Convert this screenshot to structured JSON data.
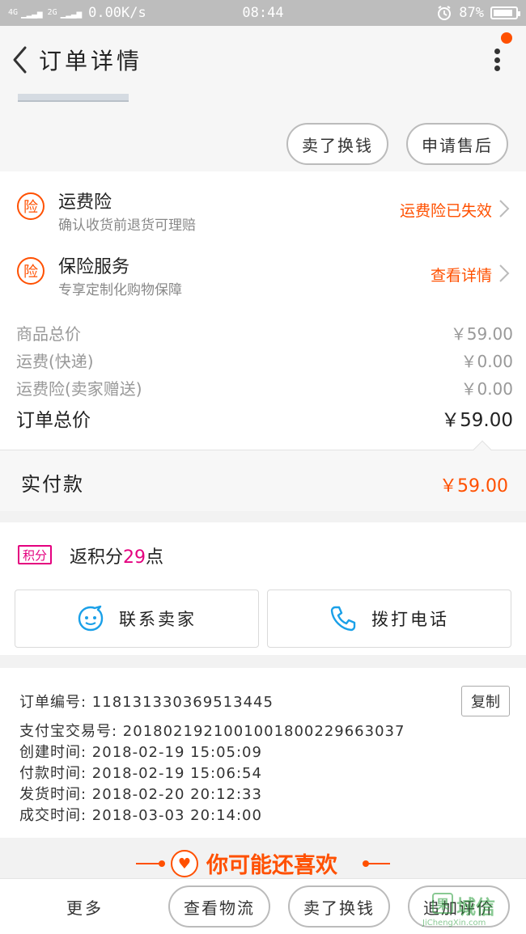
{
  "status_bar": {
    "signal_left": "4G",
    "signal_right": "2G",
    "net_speed": "0.00K/s",
    "time": "08:44",
    "battery": "87%",
    "battery_level": 0.87
  },
  "nav": {
    "title": "订单详情"
  },
  "actions_top": {
    "btn1": "卖了换钱",
    "btn2": "申请售后"
  },
  "insurance": [
    {
      "icon": "险",
      "title": "运费险",
      "subtitle": "确认收货前退货可理赔",
      "link": "运费险已失效"
    },
    {
      "icon": "险",
      "title": "保险服务",
      "subtitle": "专享定制化购物保障",
      "link": "查看详情"
    }
  ],
  "prices": {
    "goods_label": "商品总价",
    "goods_value": "￥59.00",
    "shipping_label": "运费(快递)",
    "shipping_value": "￥0.00",
    "ins_label": "运费险(卖家赠送)",
    "ins_value": "￥0.00",
    "total_label": "订单总价",
    "total_value": "￥59.00"
  },
  "payment": {
    "label": "实付款",
    "value": "￥59.00"
  },
  "points": {
    "badge": "积分",
    "prefix": "返积分",
    "count": "29",
    "suffix": "点"
  },
  "contact": {
    "seller_label": "联系卖家",
    "call_label": "拨打电话"
  },
  "order_info": {
    "order_no": "订单编号: 118131330369513445",
    "alipay_no": "支付宝交易号: 2018021921001001800229663037",
    "created": "创建时间: 2018-02-19 15:05:09",
    "paid": "付款时间: 2018-02-19 15:06:54",
    "shipped": "发货时间: 2018-02-20 20:12:33",
    "completed": "成交时间: 2018-03-03 20:14:00",
    "copy_label": "复制"
  },
  "recommend": {
    "title": "你可能还喜欢"
  },
  "bottom_bar": {
    "more": "更多",
    "logistics": "查看物流",
    "sell": "卖了换钱",
    "review": "追加评价"
  },
  "watermark": {
    "logo": "果",
    "brand": "城信",
    "url": "JiChengXin.com"
  },
  "colors": {
    "accent": "#ff5000",
    "points": "#e4007f",
    "status_bar": "#bdbdbd"
  }
}
